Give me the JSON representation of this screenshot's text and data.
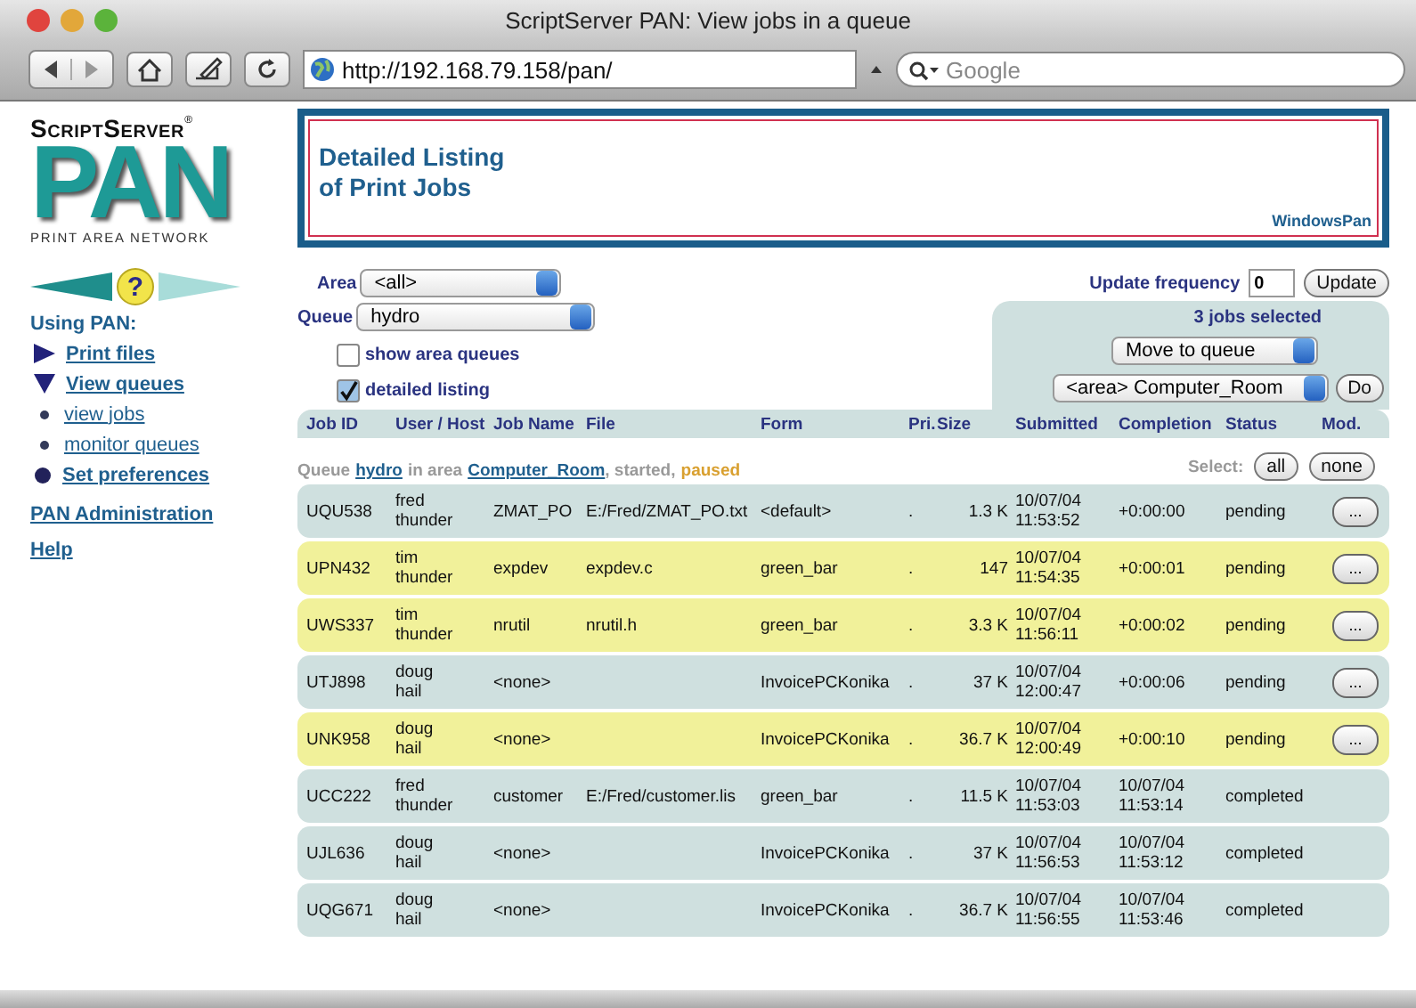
{
  "window": {
    "title": "ScriptServer PAN: View jobs in a queue"
  },
  "toolbar": {
    "url": "http://192.168.79.158/pan/",
    "search_placeholder": "Google"
  },
  "logo": {
    "brand": "ScriptServer",
    "mark": "®",
    "name": "PAN",
    "tagline": "PRINT AREA NETWORK",
    "help_glyph": "?"
  },
  "sidebar": {
    "heading": "Using PAN:",
    "items": [
      {
        "label": "Print files",
        "kind": "arrow-right",
        "sub": false
      },
      {
        "label": "View queues",
        "kind": "arrow-down",
        "sub": false
      },
      {
        "label": "view jobs",
        "kind": "bullet",
        "sub": true
      },
      {
        "label": "monitor queues",
        "kind": "bullet",
        "sub": true
      },
      {
        "label": "Set preferences",
        "kind": "ball",
        "sub": false
      }
    ],
    "links": [
      "PAN Administration",
      "Help"
    ]
  },
  "banner": {
    "title": "Detailed Listing of Print Jobs",
    "corner": "WindowsPan"
  },
  "filters": {
    "area_label": "Area",
    "area": "<all>",
    "queue_label": "Queue",
    "queue": "hydro",
    "checkboxes": [
      {
        "label": "show area queues",
        "checked": false
      },
      {
        "label": "detailed listing",
        "checked": true
      }
    ]
  },
  "update": {
    "label": "Update frequency",
    "value": "0",
    "button": "Update"
  },
  "actions": {
    "selected_count": "3 jobs selected",
    "action": "Move to queue",
    "target": "<area> Computer_Room",
    "button": "Do"
  },
  "table": {
    "columns": [
      "Job ID",
      "User / Host",
      "Job Name",
      "File",
      "Form",
      "Pri.",
      "Size",
      "Submitted",
      "Completion",
      "Status",
      "Mod."
    ],
    "queue_info": {
      "label": "Queue",
      "queue": "hydro",
      "in_area": "in area",
      "area": "Computer_Room",
      "started": ", started,",
      "paused": "paused"
    },
    "select_label": "Select:",
    "select_buttons": [
      "all",
      "none"
    ],
    "rows": [
      {
        "id": "UQU538",
        "user": "fred",
        "host": "thunder",
        "name": "ZMAT_PO",
        "file": "E:/Fred/ZMAT_PO.txt",
        "form": "<default>",
        "pri": ".",
        "size": "1.3 K",
        "submitted": [
          "10/07/04",
          "11:53:52"
        ],
        "completion": [
          "+0:00:00"
        ],
        "status": "pending",
        "mod": "...",
        "selected": false
      },
      {
        "id": "UPN432",
        "user": "tim",
        "host": "thunder",
        "name": "expdev",
        "file": "expdev.c",
        "form": "green_bar",
        "pri": ".",
        "size": "147",
        "submitted": [
          "10/07/04",
          "11:54:35"
        ],
        "completion": [
          "+0:00:01"
        ],
        "status": "pending",
        "mod": "...",
        "selected": true
      },
      {
        "id": "UWS337",
        "user": "tim",
        "host": "thunder",
        "name": "nrutil",
        "file": "nrutil.h",
        "form": "green_bar",
        "pri": ".",
        "size": "3.3 K",
        "submitted": [
          "10/07/04",
          "11:56:11"
        ],
        "completion": [
          "+0:00:02"
        ],
        "status": "pending",
        "mod": "...",
        "selected": true
      },
      {
        "id": "UTJ898",
        "user": "doug",
        "host": "hail",
        "name": "<none>",
        "form": "InvoicePCKonika",
        "pri": ".",
        "size": "37 K",
        "submitted": [
          "10/07/04",
          "12:00:47"
        ],
        "completion": [
          "+0:00:06"
        ],
        "status": "pending",
        "mod": "...",
        "selected": false
      },
      {
        "id": "UNK958",
        "user": "doug",
        "host": "hail",
        "name": "<none>",
        "form": "InvoicePCKonika",
        "pri": ".",
        "size": "36.7 K",
        "submitted": [
          "10/07/04",
          "12:00:49"
        ],
        "completion": [
          "+0:00:10"
        ],
        "status": "pending",
        "mod": "...",
        "selected": true
      },
      {
        "id": "UCC222",
        "user": "fred",
        "host": "thunder",
        "name": "customer",
        "file": "E:/Fred/customer.lis",
        "form": "green_bar",
        "pri": ".",
        "size": "11.5 K",
        "submitted": [
          "10/07/04",
          "11:53:03"
        ],
        "completion": [
          "10/07/04",
          "11:53:14"
        ],
        "status": "completed",
        "selected": false
      },
      {
        "id": "UJL636",
        "user": "doug",
        "host": "hail",
        "name": "<none>",
        "form": "InvoicePCKonika",
        "pri": ".",
        "size": "37 K",
        "submitted": [
          "10/07/04",
          "11:56:53"
        ],
        "completion": [
          "10/07/04",
          "11:53:12"
        ],
        "status": "completed",
        "selected": false
      },
      {
        "id": "UQG671",
        "user": "doug",
        "host": "hail",
        "name": "<none>",
        "form": "InvoicePCKonika",
        "pri": ".",
        "size": "36.7 K",
        "submitted": [
          "10/07/04",
          "11:56:55"
        ],
        "completion": [
          "10/07/04",
          "11:53:46"
        ],
        "status": "completed",
        "selected": false
      }
    ]
  }
}
